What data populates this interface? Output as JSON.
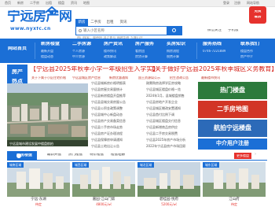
{
  "topbar": {
    "links": [
      "首页",
      "新房",
      "二手房",
      "出租",
      "楼盘",
      "资讯",
      "地图"
    ],
    "right": [
      "登录",
      "注册",
      "网站导航"
    ]
  },
  "header": {
    "logo_title": "宁远房产网",
    "logo_url": "www.nyxfc.cn",
    "search_tabs": [
      "新房",
      "二手房",
      "出租",
      "资讯"
    ],
    "search_placeholder": "输入小区名称",
    "search_hots": "热门搜索：舜德府  滨江壹号  锦绣华府  九嶷山庄",
    "wechat_label": "微信关注",
    "mobile_label": "手机版",
    "badge_line1": "免费",
    "badge_line2": "看房"
  },
  "nav": {
    "items": [
      {
        "main": "网站首页",
        "subs": []
      },
      {
        "main": "新房楼盘",
        "subs": [
          "最新开盘",
          "楼盘动态"
        ]
      },
      {
        "main": "二手房源",
        "subs": [
          "个人房源",
          "中介房源",
          "出租房源"
        ]
      },
      {
        "main": "房产资讯",
        "subs": [
          "楼市快讯",
          "政策解读",
          "装修知识"
        ]
      },
      {
        "main": "房产服务",
        "subs": [
          "看房团",
          "房贷计算"
        ]
      },
      {
        "main": "买房知识",
        "subs": [
          "购房流程",
          "税费计算"
        ]
      },
      {
        "main": "联系我们",
        "subs": [
          "楼盘合作",
          "房产中介"
        ]
      }
    ],
    "phone_label": "服务热线",
    "phone": "0746-7221889"
  },
  "hot": {
    "label_line1": "房产",
    "label_line2": "热点",
    "headline1": "【宁远县2025年秋季小学一年级招生入学实】",
    "headline2": "【关于做好宁远县2025年秋季城区义务教育】",
    "subs": [
      "关于下属于小区住宅价格",
      "宁远县城区房产信息",
      "新房优惠通知",
      "国土资源局公示",
      "招生咨询公告",
      "最新楼市快讯"
    ]
  },
  "aerial": {
    "caption": "宁远县城市建设发展中楼盘航拍"
  },
  "news": {
    "col1": [
      "宁远县城新房价格明细表",
      "宁远县房屋交易量统计",
      "宁远县新房楼盘开盘推荐",
      "宁远县县城交易房屋公告",
      "宁远县公积金政策调整",
      "宁远县城中心新盘动态",
      "宁远县房产交易备案信息",
      "宁远县二手房市场走势",
      "宁远县房产证办理流程",
      "宁远县保障房申请通知",
      "宁远县土地出让公告"
    ],
    "col2": [
      "刚需购房选择学区房攻略",
      "宁远县城区楼盘价格一览",
      "2024年1月，县城楼盘销售",
      "宁远县房地产开发企业",
      "宁远县城区棚改安置通知",
      "宁远县首付比例下调",
      "宁远县城区楼盘交付信息",
      "宁远县新增商品房供应",
      "宁远县二手房交易税费",
      "宁远县2025年房产市场分析",
      "2022年宁远县房产市场回顾"
    ]
  },
  "ads": {
    "ad1": "热门楼盘",
    "ad2": "二手房地图",
    "ad3": "航拍宁远楼盘",
    "ad4": "中介用户注册"
  },
  "new_houses": {
    "title": "新房楼盘",
    "tabs": [
      "最新开盘",
      "热门楼盘",
      "特价楼盘",
      "楼盘相册"
    ],
    "more": "更多楼盘",
    "arrow": "›"
  },
  "properties": [
    {
      "tag": "城南区域",
      "name": "宁远·东湖",
      "price": "待定"
    },
    {
      "tag": "城西区域",
      "name": "嘉园·江山门第",
      "price": "4800元/㎡"
    },
    {
      "tag": "城北区域",
      "name": "碧桂园·悦府",
      "price": "5200元/㎡"
    },
    {
      "tag": "城东区域",
      "name": "江山府",
      "price": "待定"
    }
  ],
  "colors": {
    "brand_blue": "#1b6fd6",
    "headline_red": "#d6231c",
    "badge_red": "#e6322d"
  }
}
